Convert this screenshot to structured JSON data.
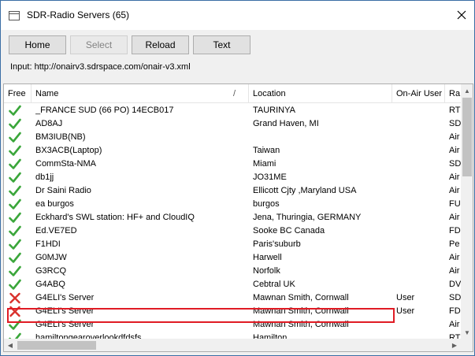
{
  "window": {
    "title": "SDR-Radio Servers (65)"
  },
  "toolbar": {
    "home_label": "Home",
    "select_label": "Select",
    "reload_label": "Reload",
    "text_label": "Text",
    "input_text": "Input: http://onairv3.sdrspace.com/onair-v3.xml"
  },
  "columns": {
    "free": "Free",
    "name": "Name",
    "sort_indicator": "/",
    "location": "Location",
    "onair_user": "On-Air User",
    "rate": "Ra"
  },
  "rows": [
    {
      "status": "check",
      "name": "_FRANCE SUD (66 PO) 14ECB017",
      "location": "TAURINYA",
      "onair": "",
      "rate": "RT"
    },
    {
      "status": "check",
      "name": "AD8AJ",
      "location": "Grand Haven, MI",
      "onair": "",
      "rate": "SD"
    },
    {
      "status": "check",
      "name": "BM3IUB(NB)",
      "location": "",
      "onair": "",
      "rate": "Air"
    },
    {
      "status": "check",
      "name": "BX3ACB(Laptop)",
      "location": "Taiwan",
      "onair": "",
      "rate": "Air"
    },
    {
      "status": "check",
      "name": "CommSta-NMA",
      "location": "Miami",
      "onair": "",
      "rate": "SD"
    },
    {
      "status": "check",
      "name": "db1jj",
      "location": "JO31ME",
      "onair": "",
      "rate": "Air"
    },
    {
      "status": "check",
      "name": "Dr Saini Radio",
      "location": "Ellicott Cjty ,Maryland USA",
      "onair": "",
      "rate": "Air"
    },
    {
      "status": "check",
      "name": "ea burgos",
      "location": "burgos",
      "onair": "",
      "rate": "FU"
    },
    {
      "status": "check",
      "name": "Eckhard's SWL station: HF+ and CloudIQ",
      "location": "Jena, Thuringia, GERMANY",
      "onair": "",
      "rate": "Air"
    },
    {
      "status": "check",
      "name": "Ed.VE7ED",
      "location": "Sooke BC Canada",
      "onair": "",
      "rate": "FD"
    },
    {
      "status": "check",
      "name": "F1HDI",
      "location": "Paris'suburb",
      "onair": "",
      "rate": "Pe"
    },
    {
      "status": "check",
      "name": "G0MJW",
      "location": "Harwell",
      "onair": "",
      "rate": "Air"
    },
    {
      "status": "check",
      "name": "G3RCQ",
      "location": "Norfolk",
      "onair": "",
      "rate": "Air"
    },
    {
      "status": "check",
      "name": "G4ABQ",
      "location": "Cebtral UK",
      "onair": "",
      "rate": "DV"
    },
    {
      "status": "cross",
      "name": "G4ELI's Server",
      "location": "Mawnan Smith, Cornwall",
      "onair": "User",
      "rate": "SD"
    },
    {
      "status": "cross",
      "name": "G4ELI's Server",
      "location": "Mawnan Smith, Cornwall",
      "onair": "User",
      "rate": "FD"
    },
    {
      "status": "check",
      "name": "G4ELI's Server",
      "location": "Mawnan Smith, Cornwall",
      "onair": "",
      "rate": "Air"
    },
    {
      "status": "check",
      "name": "hamiltongearoverlookdfdsfs",
      "location": "Hamilton",
      "onair": "",
      "rate": "RT"
    }
  ],
  "colors": {
    "check": "#3aa63a",
    "cross": "#d9302c",
    "highlight": "#e01b24"
  }
}
